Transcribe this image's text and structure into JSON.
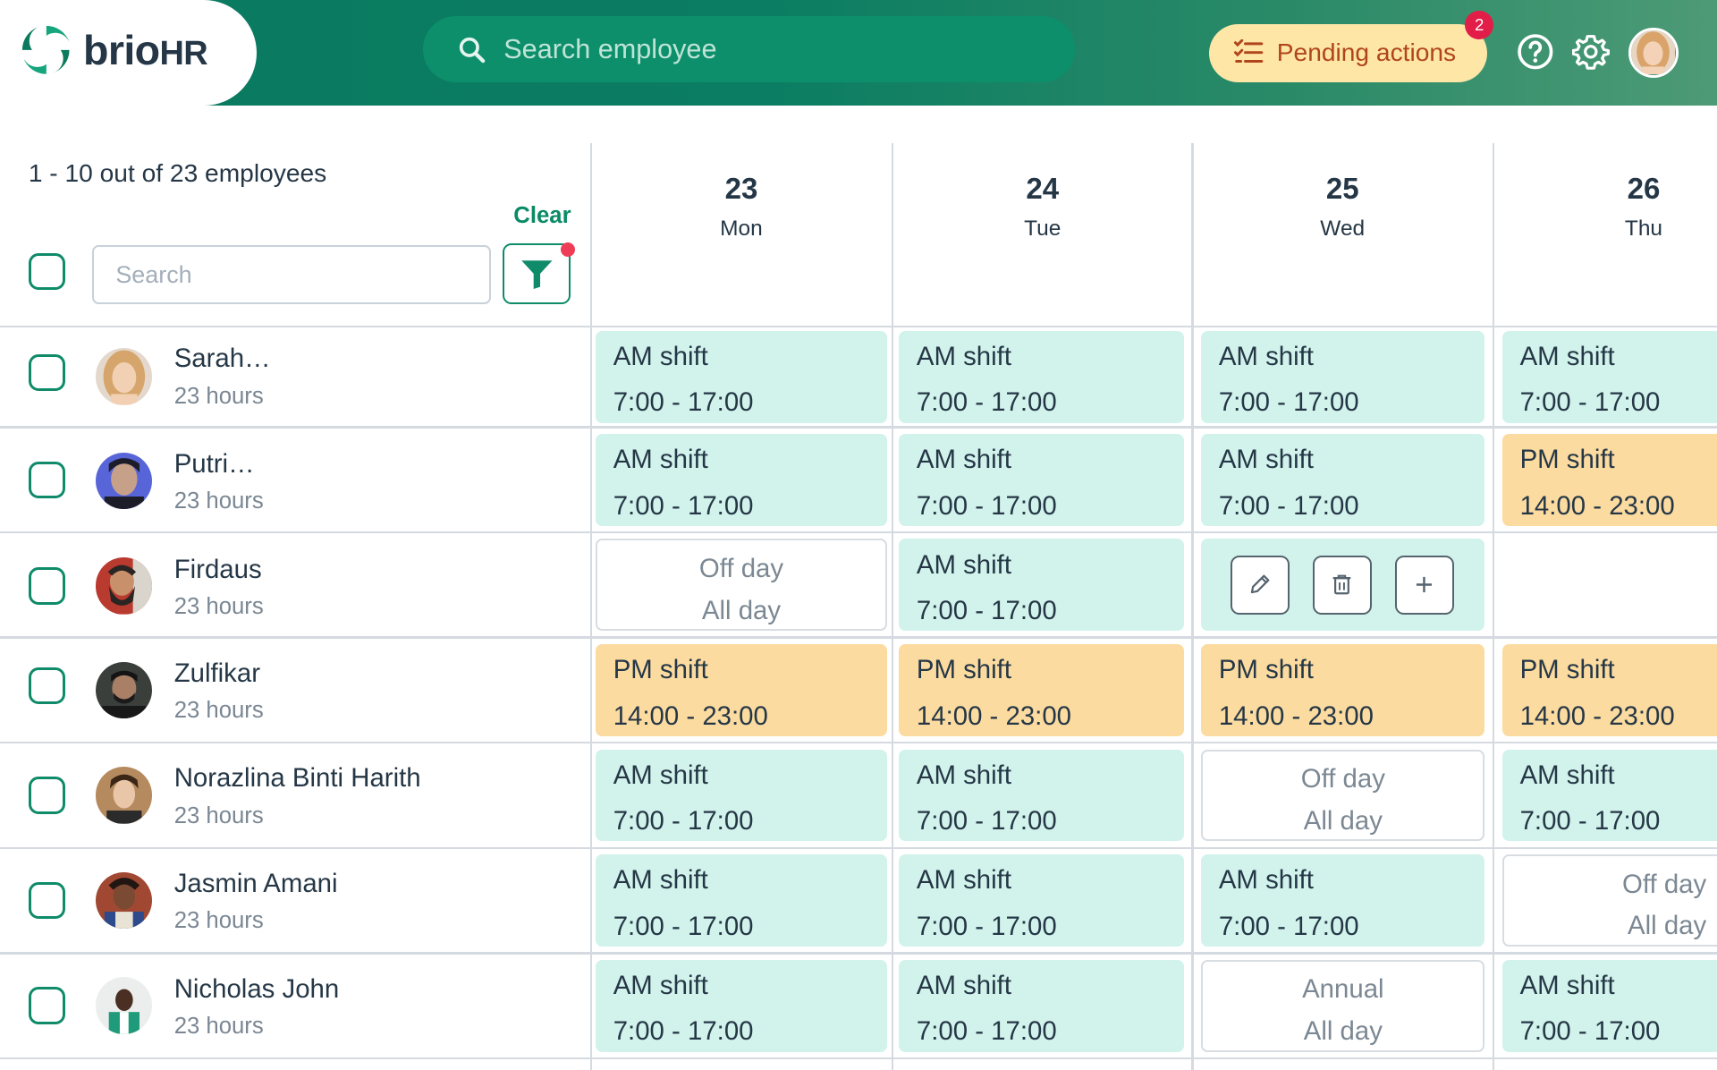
{
  "header": {
    "logo_text": "brio",
    "logo_text_bold": "HR",
    "search_placeholder": "Search employee",
    "pending_label": "Pending actions",
    "pending_count": "2",
    "colors": {
      "brand_green": "#0b7d62",
      "pending_bg": "#fde6a6",
      "pending_text": "#b0451b",
      "badge": "#e11d48"
    }
  },
  "sidebar": {
    "count_text": "1 - 10 out of 23 employees",
    "clear_label": "Clear",
    "search_placeholder": "Search",
    "filter_active": true
  },
  "days": [
    {
      "num": "23",
      "name": "Mon"
    },
    {
      "num": "24",
      "name": "Tue"
    },
    {
      "num": "25",
      "name": "Wed"
    },
    {
      "num": "26",
      "name": "Thu"
    }
  ],
  "employees": [
    {
      "name": "Sarah…",
      "hours": "23 hours"
    },
    {
      "name": "Putri…",
      "hours": "23 hours"
    },
    {
      "name": "Firdaus",
      "hours": "23 hours"
    },
    {
      "name": "Zulfikar",
      "hours": "23 hours"
    },
    {
      "name": "Norazlina Binti Harith",
      "hours": "23 hours"
    },
    {
      "name": "Jasmin Amani",
      "hours": "23 hours"
    },
    {
      "name": "Nicholas John",
      "hours": "23 hours"
    }
  ],
  "shifts": {
    "am": {
      "label": "AM shift",
      "time": "7:00 - 17:00"
    },
    "pm": {
      "label": "PM shift",
      "time": "14:00 - 23:00"
    },
    "off": {
      "label": "Off day",
      "time": "All day"
    },
    "annual": {
      "label": "Annual",
      "time": "All day"
    }
  },
  "schedule": [
    [
      "am",
      "am",
      "am",
      "am"
    ],
    [
      "am",
      "am",
      "am",
      "pm"
    ],
    [
      "off",
      "am",
      "actions",
      "empty"
    ],
    [
      "pm",
      "pm",
      "pm",
      "pm"
    ],
    [
      "am",
      "am",
      "off",
      "am"
    ],
    [
      "am",
      "am",
      "am",
      "off"
    ],
    [
      "am",
      "am",
      "annual",
      "am"
    ]
  ],
  "cell_actions": [
    "edit-button",
    "delete-button",
    "add-button"
  ],
  "shift_colors": {
    "am": "#d2f3ec",
    "pm": "#fcdba0",
    "off": "#ffffff"
  }
}
